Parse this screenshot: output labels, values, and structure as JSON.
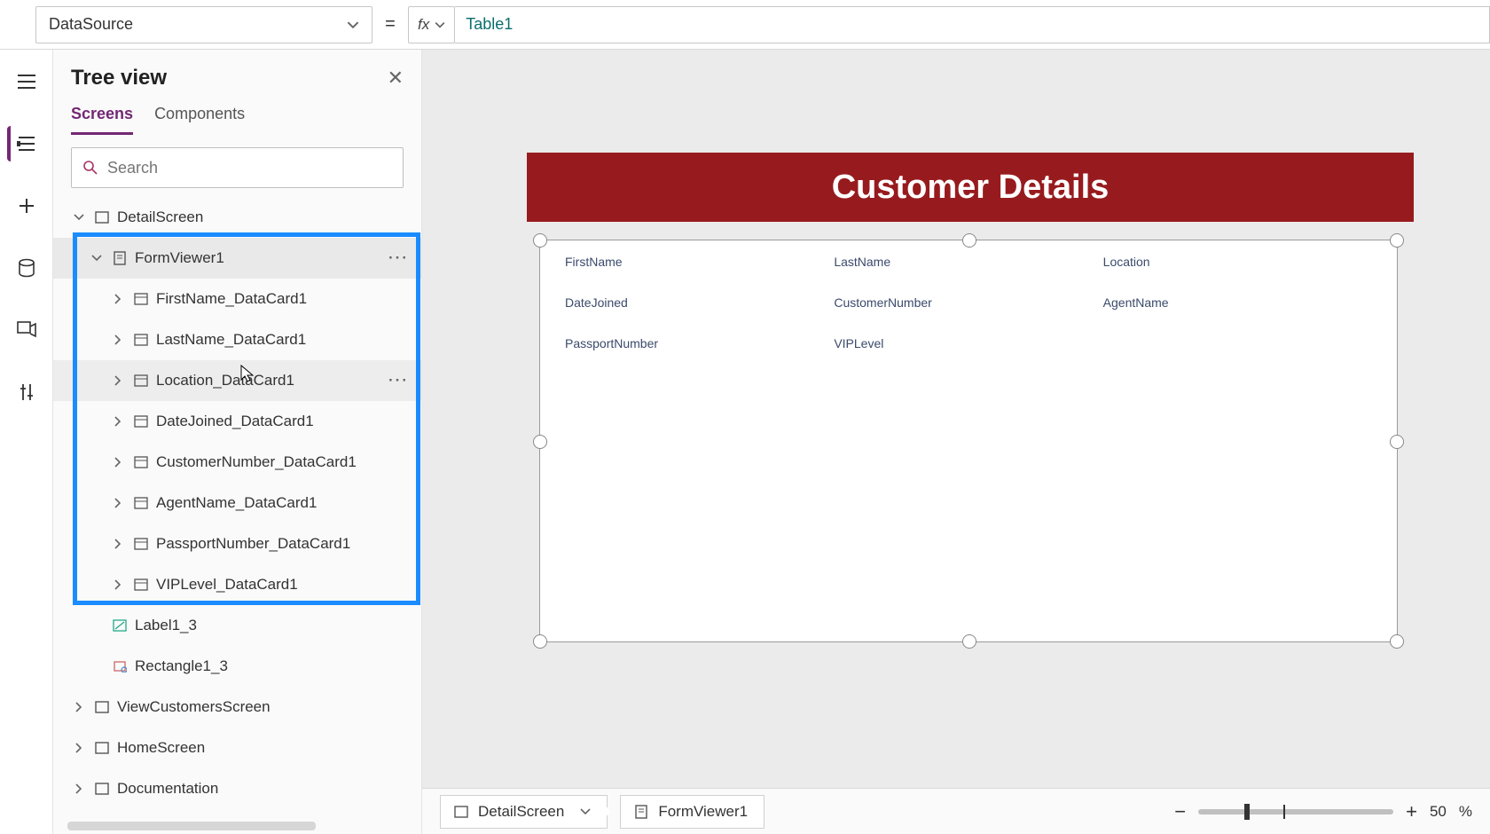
{
  "formula_bar": {
    "property": "DataSource",
    "formula": "Table1"
  },
  "tree": {
    "title": "Tree view",
    "tabs": {
      "screens": "Screens",
      "components": "Components"
    },
    "search_placeholder": "Search",
    "nodes": {
      "detailscreen": "DetailScreen",
      "formviewer": "FormViewer1",
      "datacards": [
        "FirstName_DataCard1",
        "LastName_DataCard1",
        "Location_DataCard1",
        "DateJoined_DataCard1",
        "CustomerNumber_DataCard1",
        "AgentName_DataCard1",
        "PassportNumber_DataCard1",
        "VIPLevel_DataCard1"
      ],
      "label": "Label1_3",
      "rectangle": "Rectangle1_3",
      "viewcustomers": "ViewCustomersScreen",
      "homescreen": "HomeScreen",
      "documentation": "Documentation"
    }
  },
  "canvas": {
    "banner_title": "Customer Details",
    "fields": [
      "FirstName",
      "LastName",
      "Location",
      "DateJoined",
      "CustomerNumber",
      "AgentName",
      "PassportNumber",
      "VIPLevel"
    ]
  },
  "status": {
    "crumb_screen": "DetailScreen",
    "crumb_control": "FormViewer1",
    "zoom_value": "50",
    "zoom_pct": "%"
  },
  "colors": {
    "accent": "#742774",
    "banner": "#971b1e",
    "highlight": "#1a8cff"
  }
}
